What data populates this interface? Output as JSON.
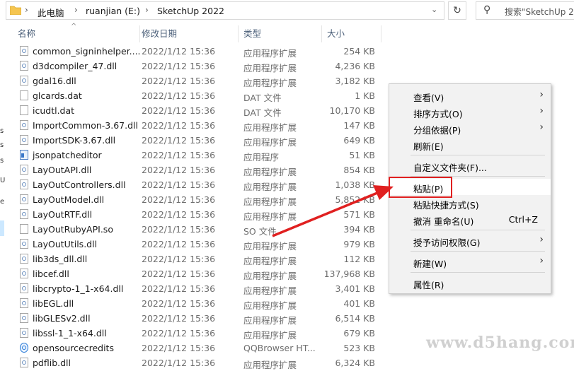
{
  "address": {
    "crumbs": [
      "此电脑",
      "ruanjian (E:)",
      "SketchUp 2022"
    ],
    "search_placeholder": "搜索\"SketchUp 20"
  },
  "nav_letters": [
    "s",
    "s",
    "s",
    "U",
    "e"
  ],
  "columns": {
    "name": "名称",
    "date": "修改日期",
    "type": "类型",
    "size": "大小"
  },
  "files": [
    {
      "name": "common_signinhelper....",
      "date": "2022/1/12 15:36",
      "type": "应用程序扩展",
      "size": "254 KB",
      "icon": "dll-icon"
    },
    {
      "name": "d3dcompiler_47.dll",
      "date": "2022/1/12 15:36",
      "type": "应用程序扩展",
      "size": "4,236 KB",
      "icon": "dll-icon"
    },
    {
      "name": "gdal16.dll",
      "date": "2022/1/12 15:36",
      "type": "应用程序扩展",
      "size": "3,182 KB",
      "icon": "dll-icon"
    },
    {
      "name": "glcards.dat",
      "date": "2022/1/12 15:36",
      "type": "DAT 文件",
      "size": "1 KB",
      "icon": "file-icon"
    },
    {
      "name": "icudtl.dat",
      "date": "2022/1/12 15:36",
      "type": "DAT 文件",
      "size": "10,170 KB",
      "icon": "file-icon"
    },
    {
      "name": "ImportCommon-3.67.dll",
      "date": "2022/1/12 15:36",
      "type": "应用程序扩展",
      "size": "147 KB",
      "icon": "dll-icon"
    },
    {
      "name": "ImportSDK-3.67.dll",
      "date": "2022/1/12 15:36",
      "type": "应用程序扩展",
      "size": "649 KB",
      "icon": "dll-icon"
    },
    {
      "name": "jsonpatcheditor",
      "date": "2022/1/12 15:36",
      "type": "应用程序",
      "size": "51 KB",
      "icon": "exe-icon"
    },
    {
      "name": "LayOutAPI.dll",
      "date": "2022/1/12 15:36",
      "type": "应用程序扩展",
      "size": "854 KB",
      "icon": "dll-icon"
    },
    {
      "name": "LayOutControllers.dll",
      "date": "2022/1/12 15:36",
      "type": "应用程序扩展",
      "size": "1,038 KB",
      "icon": "dll-icon"
    },
    {
      "name": "LayOutModel.dll",
      "date": "2022/1/12 15:36",
      "type": "应用程序扩展",
      "size": "5,852 KB",
      "icon": "dll-icon"
    },
    {
      "name": "LayOutRTF.dll",
      "date": "2022/1/12 15:36",
      "type": "应用程序扩展",
      "size": "571 KB",
      "icon": "dll-icon"
    },
    {
      "name": "LayOutRubyAPI.so",
      "date": "2022/1/12 15:36",
      "type": "SO 文件",
      "size": "394 KB",
      "icon": "file-icon"
    },
    {
      "name": "LayOutUtils.dll",
      "date": "2022/1/12 15:36",
      "type": "应用程序扩展",
      "size": "979 KB",
      "icon": "dll-icon"
    },
    {
      "name": "lib3ds_dll.dll",
      "date": "2022/1/12 15:36",
      "type": "应用程序扩展",
      "size": "112 KB",
      "icon": "dll-icon"
    },
    {
      "name": "libcef.dll",
      "date": "2022/1/12 15:36",
      "type": "应用程序扩展",
      "size": "137,968 KB",
      "icon": "dll-icon"
    },
    {
      "name": "libcrypto-1_1-x64.dll",
      "date": "2022/1/12 15:36",
      "type": "应用程序扩展",
      "size": "3,401 KB",
      "icon": "dll-icon"
    },
    {
      "name": "libEGL.dll",
      "date": "2022/1/12 15:36",
      "type": "应用程序扩展",
      "size": "401 KB",
      "icon": "dll-icon"
    },
    {
      "name": "libGLESv2.dll",
      "date": "2022/1/12 15:36",
      "type": "应用程序扩展",
      "size": "6,514 KB",
      "icon": "dll-icon"
    },
    {
      "name": "libssl-1_1-x64.dll",
      "date": "2022/1/12 15:36",
      "type": "应用程序扩展",
      "size": "679 KB",
      "icon": "dll-icon"
    },
    {
      "name": "opensourcecredits",
      "date": "2022/1/12 15:36",
      "type": "QQBrowser HT...",
      "size": "523 KB",
      "icon": "qqbrowser-icon"
    },
    {
      "name": "pdflib.dll",
      "date": "2022/1/12 15:36",
      "type": "应用程序扩展",
      "size": "6,324 KB",
      "icon": "dll-icon"
    }
  ],
  "context_menu": {
    "view": "查看(V)",
    "sort": "排序方式(O)",
    "group": "分组依据(P)",
    "refresh": "刷新(E)",
    "customize": "自定义文件夹(F)...",
    "paste": "粘贴(P)",
    "paste_shortcut": "粘贴快捷方式(S)",
    "undo": "撤消 重命名(U)",
    "undo_shortcut": "Ctrl+Z",
    "access": "授予访问权限(G)",
    "new": "新建(W)",
    "properties": "属性(R)"
  },
  "annotation_color": "#e02020",
  "watermark": "www.d5hang.com"
}
